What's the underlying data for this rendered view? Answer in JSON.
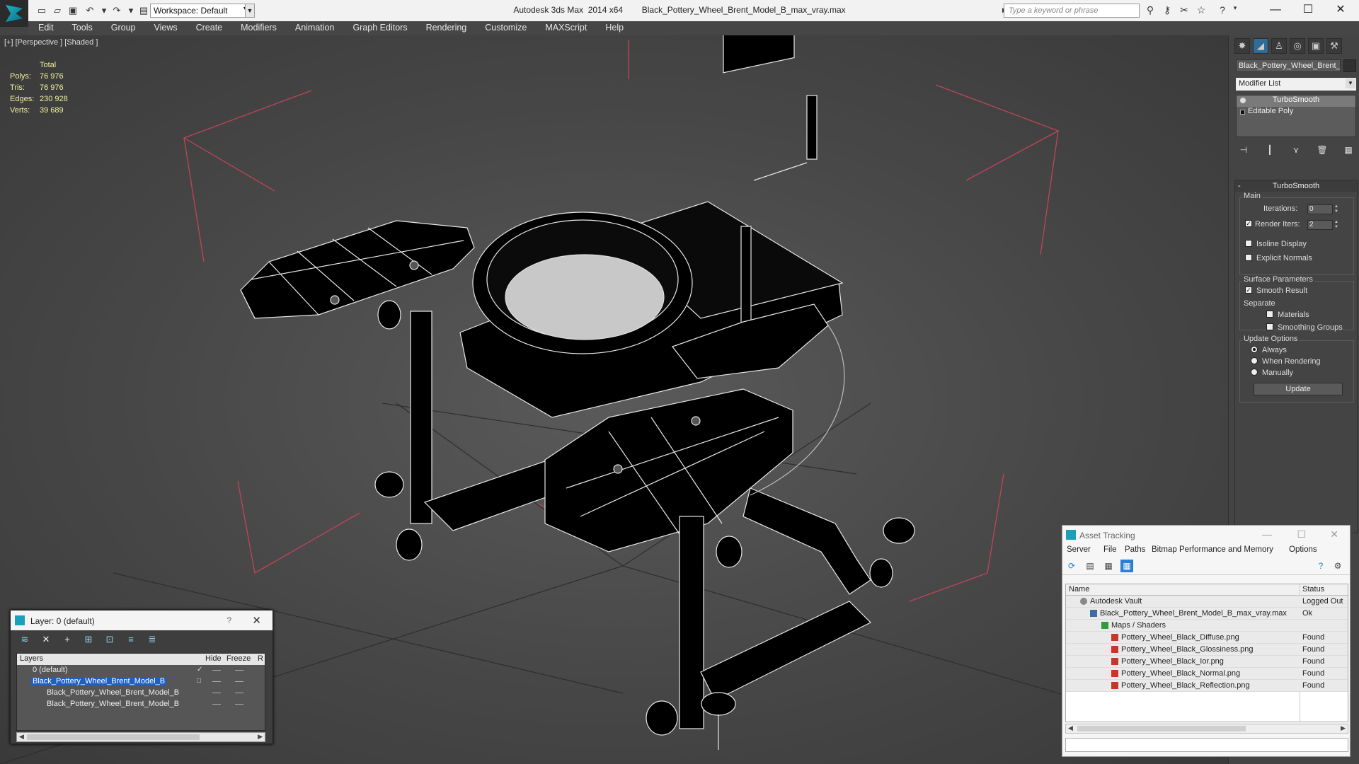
{
  "titlebar": {
    "workspace": "Workspace: Default",
    "app_title": "Autodesk 3ds Max  2014 x64",
    "file_title": "Black_Pottery_Wheel_Brent_Model_B_max_vray.max",
    "search_placeholder": "Type a keyword or phrase"
  },
  "menu": [
    "Edit",
    "Tools",
    "Group",
    "Views",
    "Create",
    "Modifiers",
    "Animation",
    "Graph Editors",
    "Rendering",
    "Customize",
    "MAXScript",
    "Help"
  ],
  "viewport": {
    "label": "[+] [Perspective ] [Shaded ]",
    "stats": {
      "header": "Total",
      "rows": [
        {
          "k": "Polys:",
          "v": "76 976"
        },
        {
          "k": "Tris:",
          "v": "76 976"
        },
        {
          "k": "Edges:",
          "v": "230 928"
        },
        {
          "k": "Verts:",
          "v": "39 689"
        }
      ]
    }
  },
  "command_panel": {
    "object_name": "Black_Pottery_Wheel_Brent_",
    "modifier_list": "Modifier List",
    "stack": [
      "TurboSmooth",
      "Editable Poly"
    ],
    "rollout_title": "TurboSmooth",
    "main_label": "Main",
    "iterations_label": "Iterations:",
    "iterations_value": "0",
    "render_iters_label": "Render Iters:",
    "render_iters_value": "2",
    "isoline": "Isoline Display",
    "explicit_normals": "Explicit Normals",
    "surface_params": "Surface Parameters",
    "smooth_result": "Smooth Result",
    "separate": "Separate",
    "materials": "Materials",
    "smoothing_groups": "Smoothing Groups",
    "update_options": "Update Options",
    "always": "Always",
    "when_rendering": "When Rendering",
    "manually": "Manually",
    "update_btn": "Update"
  },
  "layer_panel": {
    "title": "Layer: 0 (default)",
    "help": "?",
    "col_layers": "Layers",
    "col_hide": "Hide",
    "col_freeze": "Freeze",
    "col_r": "R",
    "rows": [
      {
        "name": "0 (default)",
        "indent": 0
      },
      {
        "name": "Black_Pottery_Wheel_Brent_Model_B",
        "indent": 0
      },
      {
        "name": "Black_Pottery_Wheel_Brent_Model_B",
        "indent": 1
      },
      {
        "name": "Black_Pottery_Wheel_Brent_Model_B",
        "indent": 1
      }
    ]
  },
  "asset_panel": {
    "title": "Asset Tracking",
    "menu": [
      "Server",
      "File",
      "Paths",
      "Bitmap Performance and Memory",
      "Options"
    ],
    "col_name": "Name",
    "col_status": "Status",
    "rows": [
      {
        "name": "Autodesk Vault",
        "status": "Logged Out",
        "icon": "vault"
      },
      {
        "name": "Black_Pottery_Wheel_Brent_Model_B_max_vray.max",
        "status": "Ok",
        "icon": "max"
      },
      {
        "name": "Maps / Shaders",
        "status": "",
        "icon": "map"
      },
      {
        "name": "Pottery_Wheel_Black_Diffuse.png",
        "status": "Found",
        "icon": "png"
      },
      {
        "name": "Pottery_Wheel_Black_Glossiness.png",
        "status": "Found",
        "icon": "png"
      },
      {
        "name": "Pottery_Wheel_Black_Ior.png",
        "status": "Found",
        "icon": "png"
      },
      {
        "name": "Pottery_Wheel_Black_Normal.png",
        "status": "Found",
        "icon": "png"
      },
      {
        "name": "Pottery_Wheel_Black_Reflection.png",
        "status": "Found",
        "icon": "png"
      }
    ]
  }
}
